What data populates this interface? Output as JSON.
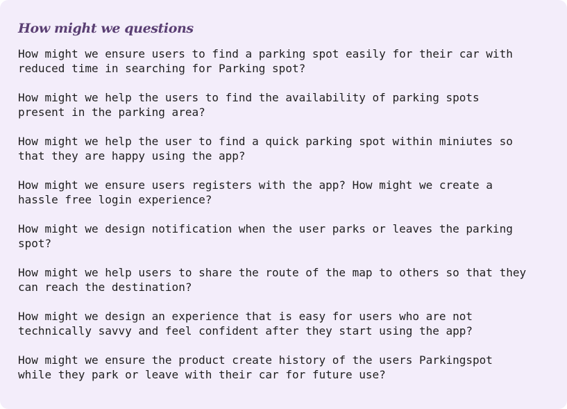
{
  "card": {
    "title": "How might we questions",
    "questions": [
      "How might we ensure users to find a parking spot easily for their car with\nreduced time in searching for Parking spot?",
      "How might we help the users to find the availability of parking spots\npresent in the parking area?",
      "How might we help the user to find a quick parking spot within miniutes so\nthat they are happy using the app?",
      "How might we ensure users registers with the app? How might we create a\nhassle free login experience?",
      "How might we design notification when the user parks or leaves the parking\nspot?",
      "How might we help users to share the route of the map to others so that they\ncan reach the destination?",
      "How might we design an experience that is easy for users who are not\ntechnically savvy and feel confident after they start using the app?",
      "How might we ensure the product create history of the users Parkingspot\nwhile they park or leave with their car for future use?"
    ]
  },
  "colors": {
    "background": "#f3edfa",
    "title": "#5a3f73",
    "text": "#1e1e1e"
  }
}
